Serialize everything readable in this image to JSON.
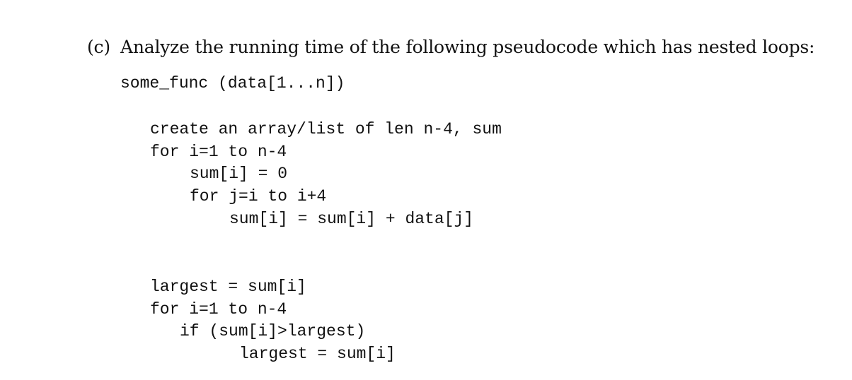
{
  "question": {
    "label": "(c)",
    "text": "Analyze the running time of the following pseudocode which has nested loops:"
  },
  "code": {
    "signature": "some_func (data[1...n])",
    "lines": [
      "create an array/list of len n-4, sum",
      "for i=1 to n-4",
      "sum[i] = 0",
      "for j=i to i+4",
      "sum[i] = sum[i] + data[j]",
      "largest = sum[i]",
      "for i=1 to n-4",
      "if (sum[i]>largest)",
      "largest = sum[i]"
    ]
  }
}
